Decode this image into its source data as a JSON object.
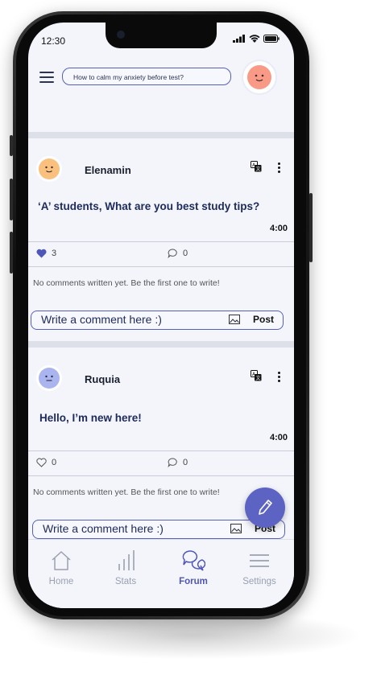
{
  "status_bar": {
    "time": "12:30"
  },
  "header": {
    "search_placeholder": "How to calm my anxiety before test?"
  },
  "posts": [
    {
      "username": "Elenamin",
      "text": "‘A’ students, What are you best study tips?",
      "time": "4:00",
      "likes": "3",
      "comments": "0",
      "no_comments_text": "No comments written yet. Be the first one to write!",
      "comment_placeholder": "Write a comment here :)",
      "post_label": "Post",
      "avatar_color": "#f9c07e"
    },
    {
      "username": "Ruquia",
      "text": "Hello, I’m new here!",
      "time": "4:00",
      "likes": "0",
      "comments": "0",
      "no_comments_text": "No comments written yet. Be the first one to write!",
      "comment_placeholder": "Write a comment here :)",
      "post_label": "Post",
      "avatar_color": "#aab4ef"
    }
  ],
  "nav": {
    "items": [
      {
        "label": "Home",
        "icon": "home-icon"
      },
      {
        "label": "Stats",
        "icon": "stats-icon"
      },
      {
        "label": "Forum",
        "icon": "forum-icon",
        "active": true
      },
      {
        "label": "Settings",
        "icon": "settings-icon"
      }
    ]
  },
  "colors": {
    "accent": "#5c63c2",
    "heart": "#4f56b6",
    "profile_avatar": "#f89a85"
  }
}
